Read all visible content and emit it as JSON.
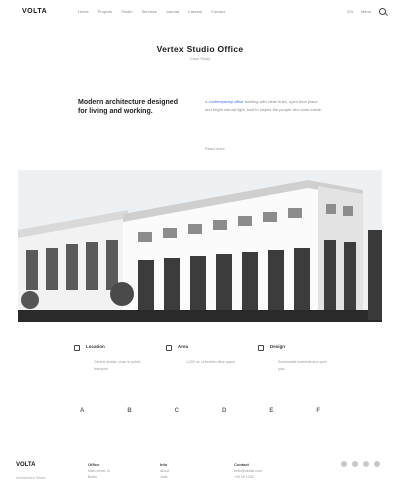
{
  "nav": {
    "logo": "VOLTA",
    "links": [
      "Home",
      "Projects",
      "Studio",
      "Services",
      "Journal",
      "Careers",
      "Contact"
    ],
    "right_links": [
      "EN",
      "Menu"
    ],
    "search_icon": "search-icon"
  },
  "hero": {
    "title": "Vertex Studio Office",
    "subtitle": "Case Study"
  },
  "intro": {
    "heading": "Modern architecture designed for living and working.",
    "text_before": "A ",
    "text_highlight": "contemporary office",
    "text_after": " building with clean lines, open floor plans and bright natural light, built to inspire the people who work inside.",
    "link": "Read more"
  },
  "features": [
    {
      "icon": "square-icon",
      "title": "Location",
      "desc": "Central district, close to public transport"
    },
    {
      "icon": "square-icon",
      "title": "Area",
      "desc": "4,200 m² of flexible office space"
    },
    {
      "icon": "square-icon",
      "title": "Design",
      "desc": "Sustainable materials and open plan"
    }
  ],
  "logos": [
    "A",
    "B",
    "C",
    "D",
    "E",
    "F"
  ],
  "footer": {
    "logo": "VOLTA",
    "tagline": "Architecture Studio",
    "col1_title": "Office",
    "col1_lines": [
      "Main street 12",
      "Berlin"
    ],
    "col2_title": "Info",
    "col2_lines": [
      "About",
      "Jobs"
    ],
    "col3_title": "Contact",
    "col3_lines": [
      "hello@studio.com",
      "+49 30 1234"
    ],
    "social_icons": [
      "circle-icon",
      "circle-icon",
      "circle-icon",
      "circle-icon"
    ]
  },
  "colors": {
    "accent": "#3a6fd8",
    "text": "#1a1a1a",
    "muted": "#999999"
  }
}
